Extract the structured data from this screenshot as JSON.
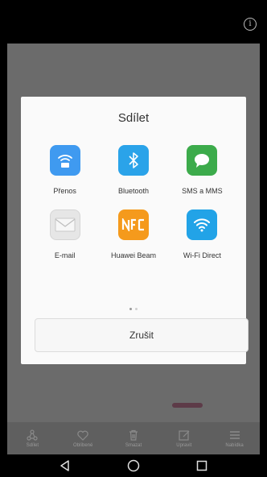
{
  "dialog": {
    "title": "Sdílet",
    "apps": [
      {
        "label": "Přenos",
        "icon": "transfer-icon",
        "color": "#3f9af0"
      },
      {
        "label": "Bluetooth",
        "icon": "bluetooth-icon",
        "color": "#2aa3e9"
      },
      {
        "label": "SMS a MMS",
        "icon": "message-icon",
        "color": "#3cab4b"
      },
      {
        "label": "E-mail",
        "icon": "email-icon",
        "color": "#e6e6e6"
      },
      {
        "label": "Huawei Beam",
        "icon": "nfc-icon",
        "color": "#f59a1c"
      },
      {
        "label": "Wi-Fi Direct",
        "icon": "wifi-direct-icon",
        "color": "#22a3e7"
      }
    ],
    "page_indicator": {
      "current": 1,
      "total": 2
    },
    "cancel_label": "Zrušit"
  },
  "bottom_actions": [
    {
      "label": "Sdílet",
      "icon": "share-icon"
    },
    {
      "label": "Oblíbené",
      "icon": "heart-icon"
    },
    {
      "label": "Smazat",
      "icon": "trash-icon"
    },
    {
      "label": "Upravit",
      "icon": "edit-icon"
    },
    {
      "label": "Nabídka",
      "icon": "menu-icon"
    }
  ],
  "navbar": {
    "back_icon": "back-icon",
    "home_icon": "home-icon",
    "recents_icon": "recents-icon"
  },
  "topbar": {
    "info_icon": "info-icon",
    "info_glyph": "i"
  }
}
